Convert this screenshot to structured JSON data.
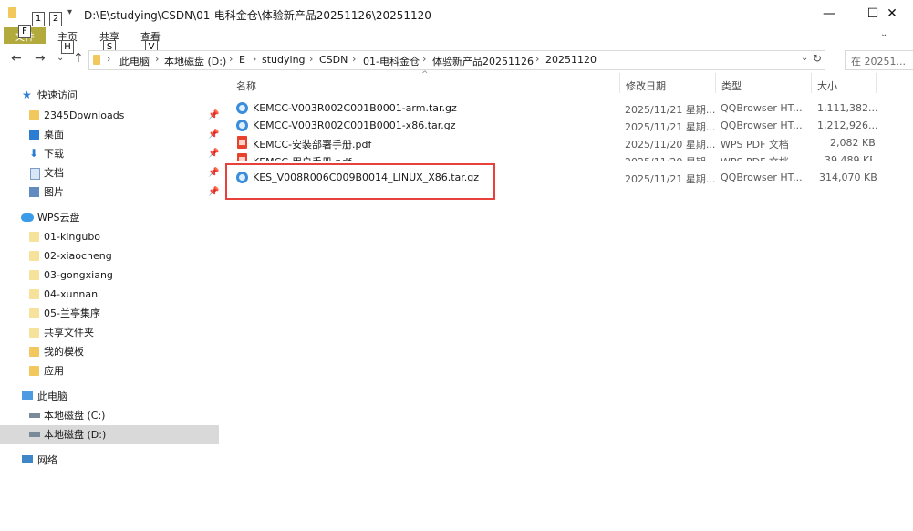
{
  "window": {
    "title": "D:\\E\\studying\\CSDN\\01-电科金仓\\体验新产品20251126\\20251120",
    "qat_keytips": [
      "1",
      "2"
    ],
    "minimize_glyph": "—",
    "maximize_glyph": "☐",
    "close_glyph": "✕"
  },
  "ribbon": {
    "file_tab": "文件",
    "file_keytip": "F",
    "tabs": [
      {
        "label": "主页",
        "keytip": "H"
      },
      {
        "label": "共享",
        "keytip": "S"
      },
      {
        "label": "查看",
        "keytip": "V"
      }
    ]
  },
  "address": {
    "crumbs": [
      "此电脑",
      "本地磁盘 (D:)",
      "E",
      "studying",
      "CSDN",
      "01-电科金仓",
      "体验新产品20251126",
      "20251120"
    ],
    "search_placeholder": "在 20251..."
  },
  "sidebar": {
    "quick_access": "快速访问",
    "quick_items": [
      "2345Downloads",
      "桌面",
      "下载",
      "文档",
      "图片"
    ],
    "wps": "WPS云盘",
    "wps_items": [
      "01-kingubo",
      "02-xiaocheng",
      "03-gongxiang",
      "04-xunnan",
      "05-兰亭集序",
      "共享文件夹",
      "我的模板",
      "应用"
    ],
    "this_pc": "此电脑",
    "drives": [
      "本地磁盘 (C:)",
      "本地磁盘 (D:)"
    ],
    "network": "网络"
  },
  "list": {
    "headers": {
      "name": "名称",
      "date": "修改日期",
      "type": "类型",
      "size": "大小"
    },
    "sort_indicator": "^",
    "rows": [
      {
        "name": "KEMCC-V003R002C001B0001-arm.tar.gz",
        "date": "2025/11/21 星期...",
        "type": "QQBrowser HT...",
        "size": "1,111,382...",
        "icon": "gz"
      },
      {
        "name": "KEMCC-V003R002C001B0001-x86.tar.gz",
        "date": "2025/11/21 星期...",
        "type": "QQBrowser HT...",
        "size": "1,212,926...",
        "icon": "gz"
      },
      {
        "name": "KEMCC-安装部署手册.pdf",
        "date": "2025/11/20 星期...",
        "type": "WPS PDF 文档",
        "size": "2,082 KB",
        "icon": "pdf"
      },
      {
        "name": "KEMCC-用户手册.pdf",
        "date": "2025/11/20 星期...",
        "type": "WPS PDF 文档",
        "size": "39,489 KB",
        "icon": "pdf"
      },
      {
        "name": "KES_V008R006C009B0014_LINUX_X86.tar.gz",
        "date": "2025/11/21 星期...",
        "type": "QQBrowser HT...",
        "size": "314,070 KB",
        "icon": "gz"
      }
    ]
  },
  "colors": {
    "highlight": "#e8403a",
    "file_tab": "#b2aa3c",
    "selected": "#d9d9d9"
  }
}
